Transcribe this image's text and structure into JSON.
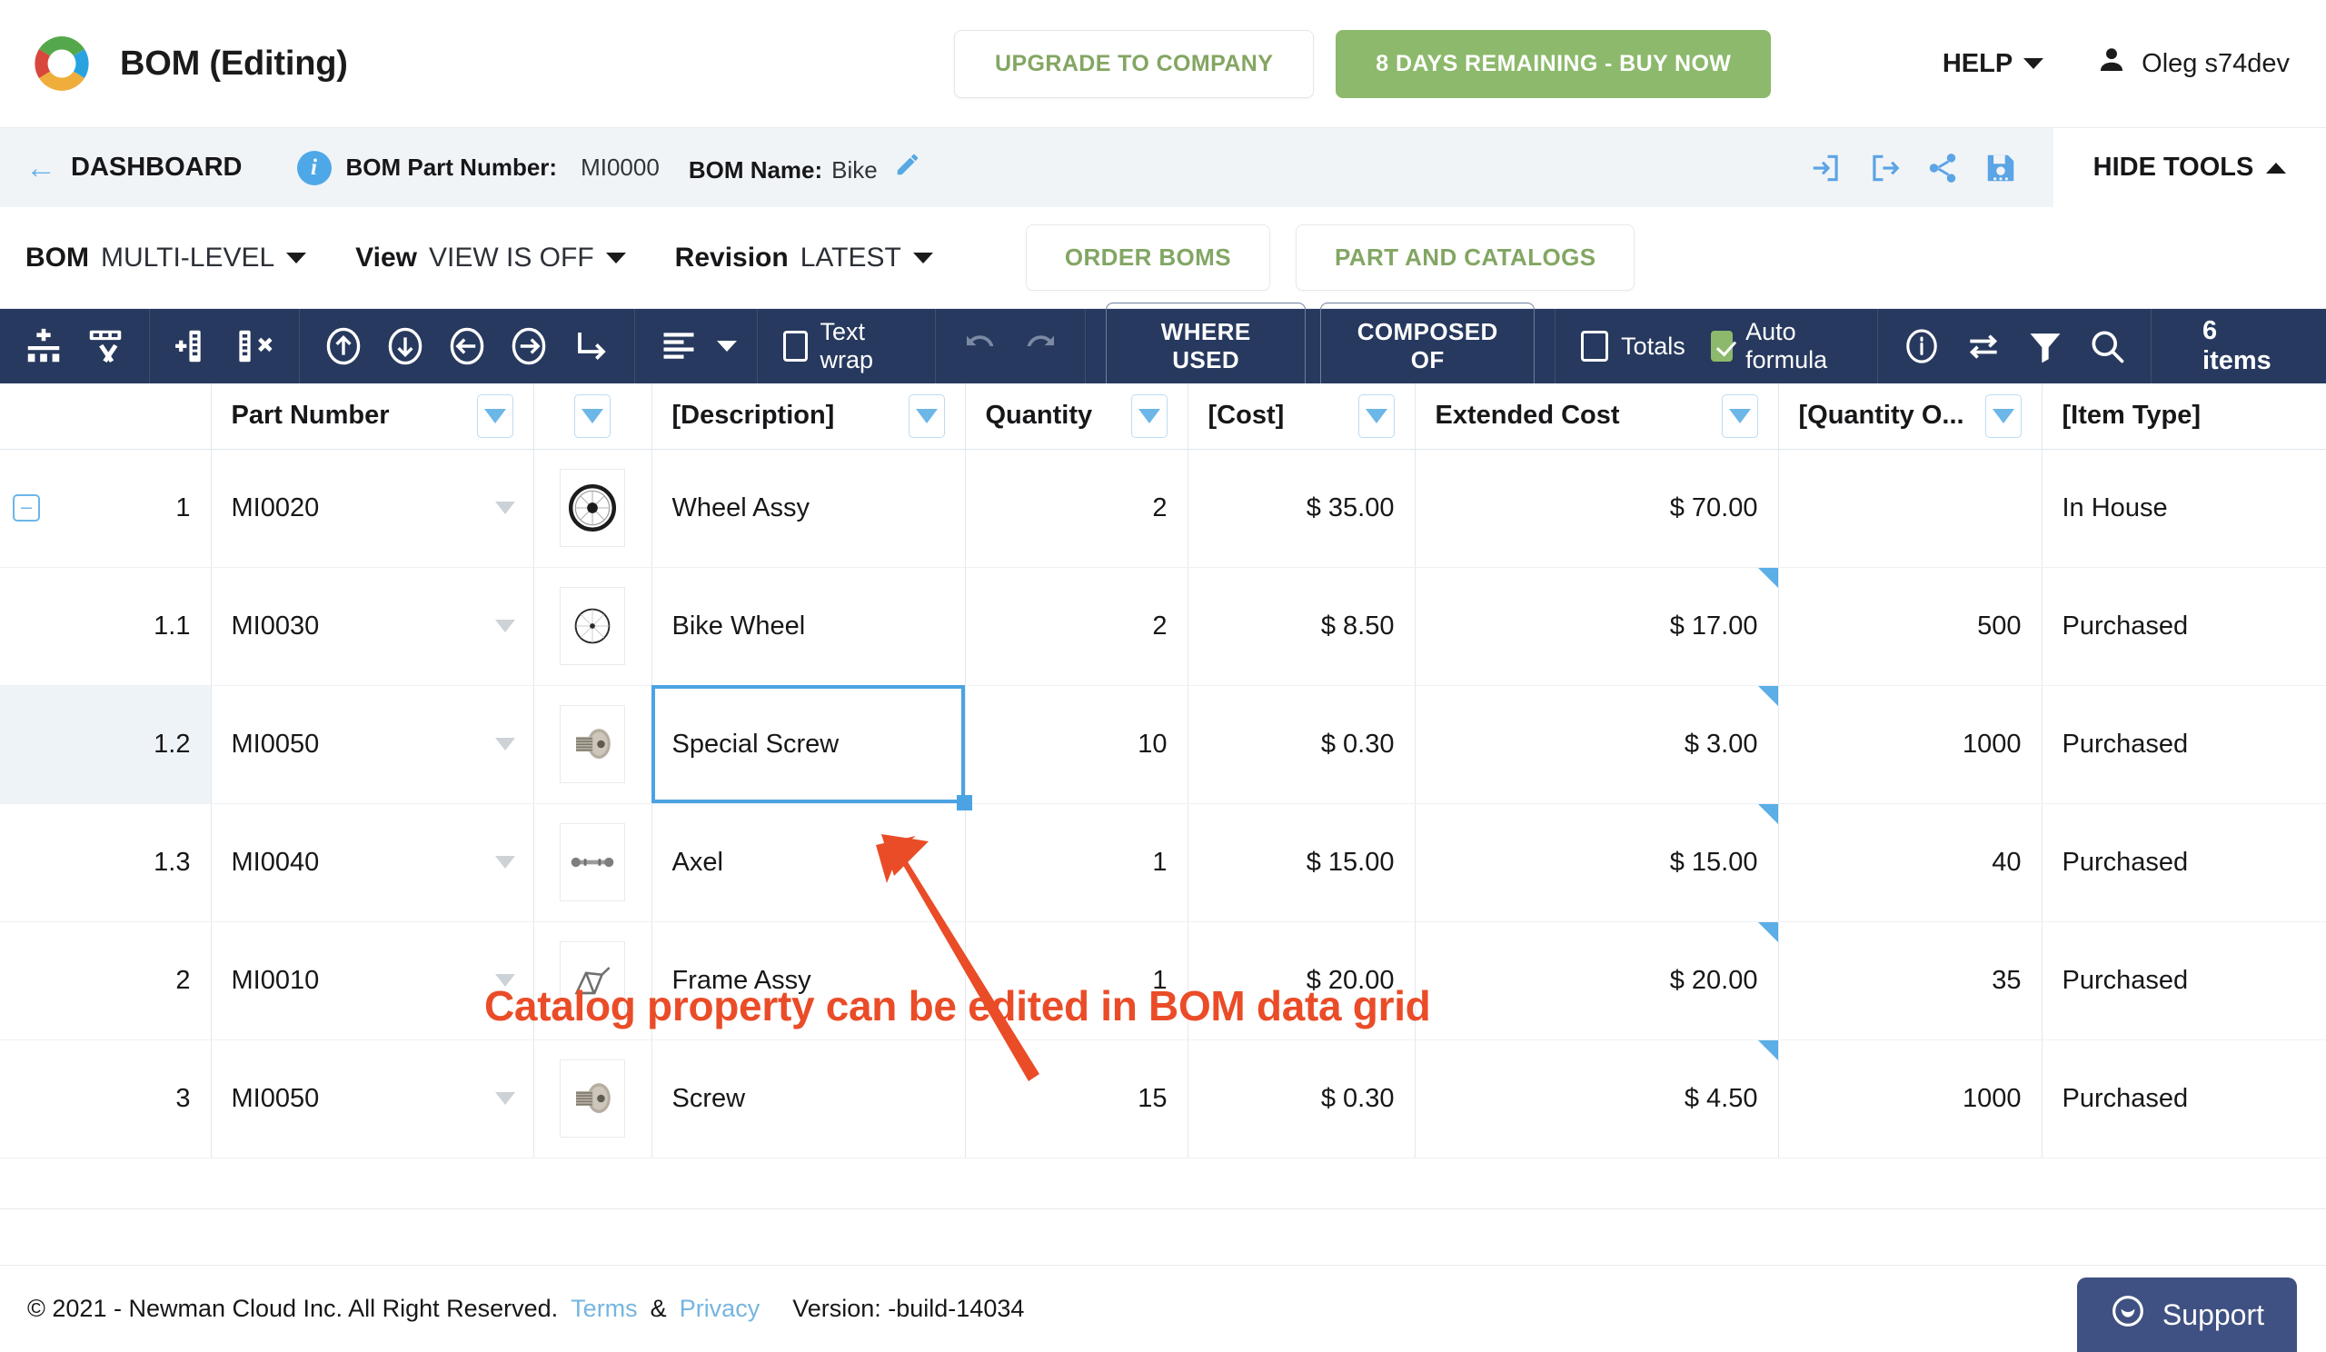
{
  "header": {
    "app_title": "BOM (Editing)",
    "logo_icon": "ring-logo-icon",
    "upgrade_label": "UPGRADE TO COMPANY",
    "buy_label": "8 DAYS REMAINING - BUY NOW",
    "help_label": "HELP",
    "user_name": "Oleg s74dev",
    "user_icon": "person-icon",
    "colors": {
      "buy_green": "#8cb96b",
      "link_green": "#83a662"
    }
  },
  "breadcrumb": {
    "back_icon": "arrow-left-icon",
    "dashboard_label": "DASHBOARD",
    "info_icon": "info-icon",
    "part_number_label": "BOM Part Number:",
    "part_number_value": "MI0000",
    "bom_name_label": "BOM Name:",
    "bom_name_value": "Bike",
    "edit_icon": "pencil-icon",
    "actions": [
      "import-icon",
      "export-icon",
      "share-icon",
      "save-icon"
    ],
    "hide_tools_label": "HIDE TOOLS"
  },
  "filterbar": {
    "selectors": [
      {
        "label": "BOM",
        "value": "MULTI-LEVEL"
      },
      {
        "label": "View",
        "value": "VIEW IS OFF"
      },
      {
        "label": "Revision",
        "value": "LATEST"
      }
    ],
    "order_boms_label": "ORDER BOMS",
    "part_catalogs_label": "PART AND CATALOGS"
  },
  "toolbar": {
    "icons_group1": [
      "add-row-icon",
      "delete-row-icon"
    ],
    "icons_group2": [
      "add-column-icon",
      "delete-column-icon"
    ],
    "icons_group3": [
      "move-up-icon",
      "move-down-icon",
      "move-left-icon",
      "move-right-icon",
      "indent-icon"
    ],
    "align_icon": "align-left-icon",
    "text_wrap_label": "Text wrap",
    "text_wrap_checked": false,
    "undo_icon": "undo-icon",
    "redo_icon": "redo-icon",
    "where_used_label": "WHERE USED",
    "composed_of_label": "COMPOSED OF",
    "totals_label": "Totals",
    "totals_checked": false,
    "auto_formula_label": "Auto formula",
    "auto_formula_checked": true,
    "right_icons": [
      "info-icon",
      "swap-icon",
      "filter-icon",
      "search-icon"
    ],
    "items_count_label": "6 items",
    "colors": {
      "bar_bg": "#27395e",
      "check_on": "#8cb96b"
    }
  },
  "grid": {
    "columns": [
      {
        "key": "level",
        "label": "",
        "filter": false,
        "align": "right"
      },
      {
        "key": "part",
        "label": "Part Number",
        "filter": true,
        "align": "left"
      },
      {
        "key": "thumb",
        "label": "",
        "filter": true,
        "align": "center"
      },
      {
        "key": "desc",
        "label": "[Description]",
        "filter": true,
        "align": "left"
      },
      {
        "key": "qty",
        "label": "Quantity",
        "filter": true,
        "align": "right"
      },
      {
        "key": "cost",
        "label": "[Cost]",
        "filter": true,
        "align": "right"
      },
      {
        "key": "ext",
        "label": "Extended Cost",
        "filter": true,
        "align": "right"
      },
      {
        "key": "qtyonhand",
        "label": "[Quantity O...",
        "filter": true,
        "align": "right"
      },
      {
        "key": "itemtype",
        "label": "[Item Type]",
        "filter": false,
        "align": "left"
      }
    ],
    "rows": [
      {
        "level": "1",
        "part": "MI0020",
        "thumb": "wheel-large-icon",
        "desc": "Wheel Assy",
        "qty": "2",
        "cost": "$ 35.00",
        "ext": "$ 70.00",
        "qtyonhand": "",
        "itemtype": "In House",
        "expandable": true
      },
      {
        "level": "1.1",
        "part": "MI0030",
        "thumb": "wheel-small-icon",
        "desc": "Bike Wheel",
        "qty": "2",
        "cost": "$ 8.50",
        "ext": "$ 17.00",
        "qtyonhand": "500",
        "itemtype": "Purchased",
        "expandable": false
      },
      {
        "level": "1.2",
        "part": "MI0050",
        "thumb": "screw-icon",
        "desc": "Special Screw",
        "qty": "10",
        "cost": "$ 0.30",
        "ext": "$ 3.00",
        "qtyonhand": "1000",
        "itemtype": "Purchased",
        "expandable": false
      },
      {
        "level": "1.3",
        "part": "MI0040",
        "thumb": "axel-icon",
        "desc": "Axel",
        "qty": "1",
        "cost": "$ 15.00",
        "ext": "$ 15.00",
        "qtyonhand": "40",
        "itemtype": "Purchased",
        "expandable": false
      },
      {
        "level": "2",
        "part": "MI0010",
        "thumb": "frame-icon",
        "desc": "Frame Assy",
        "qty": "1",
        "cost": "$ 20.00",
        "ext": "$ 20.00",
        "qtyonhand": "35",
        "itemtype": "Purchased",
        "expandable": false
      },
      {
        "level": "3",
        "part": "MI0050",
        "thumb": "screw-icon",
        "desc": "Screw",
        "qty": "15",
        "cost": "$ 0.30",
        "ext": "$ 4.50",
        "qtyonhand": "1000",
        "itemtype": "Purchased",
        "expandable": false
      }
    ],
    "selected_cell": {
      "row_index": 2,
      "column_key": "desc",
      "value": "Special Screw"
    }
  },
  "annotation": {
    "text": "Catalog property can be edited in BOM data grid",
    "color": "#ea4c28"
  },
  "footer": {
    "copyright": "© 2021 - Newman Cloud Inc. All Right Reserved.",
    "terms_label": "Terms",
    "amp": "&",
    "privacy_label": "Privacy",
    "version": "Version: -build-14034",
    "support_label": "Support",
    "support_icon": "smiley-icon"
  }
}
